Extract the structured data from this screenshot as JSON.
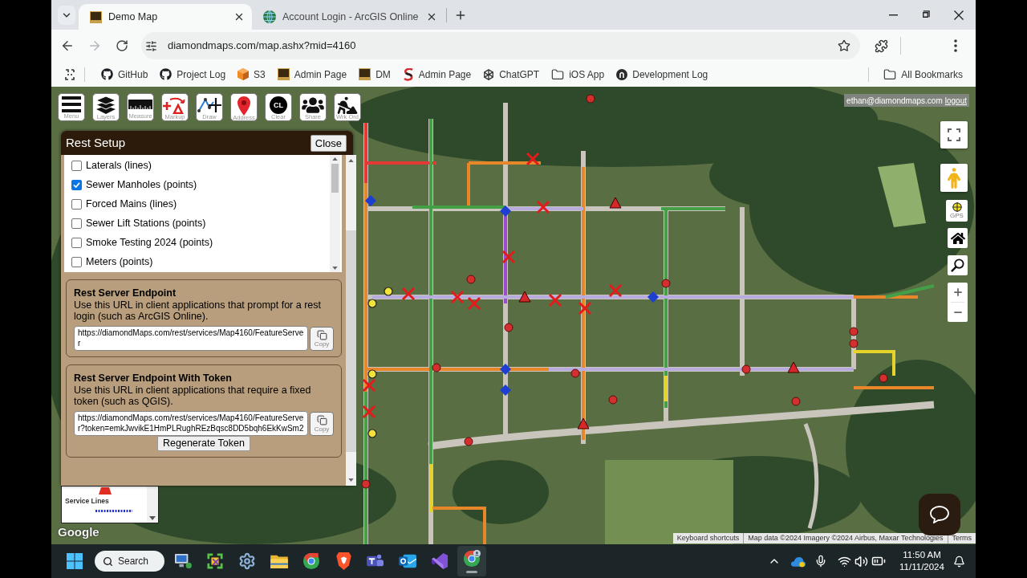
{
  "browser": {
    "tabs": [
      {
        "title": "Demo Map",
        "kind": "dm",
        "selected": true
      },
      {
        "title": "Account Login - ArcGIS Online",
        "kind": "globe",
        "selected": false
      }
    ],
    "address": {
      "url": "diamondmaps.com/map.ashx?mid=4160",
      "forward_disabled": true
    },
    "bookmarks": [
      {
        "label": "GitHub",
        "kind": "github"
      },
      {
        "label": "Project Log",
        "kind": "github"
      },
      {
        "label": "S3",
        "kind": "cube"
      },
      {
        "label": "Admin Page",
        "kind": "dm"
      },
      {
        "label": "DM",
        "kind": "dm"
      },
      {
        "label": "Admin Page",
        "kind": "swirl"
      },
      {
        "label": "ChatGPT",
        "kind": "knot"
      },
      {
        "label": "iOS App",
        "kind": "folder"
      },
      {
        "label": "Development Log",
        "kind": "badge"
      }
    ],
    "all_bookmarks": "All Bookmarks"
  },
  "map": {
    "account": {
      "email": "ethan@diamondmaps.com",
      "link": "logout"
    },
    "toolbar": [
      {
        "label": "Menu",
        "kind": "menu"
      },
      {
        "label": "Layers",
        "kind": "layers"
      },
      {
        "label": "Measure",
        "kind": "measure"
      },
      {
        "label": "Markup",
        "kind": "markup"
      },
      {
        "label": "Draw",
        "kind": "draw"
      },
      {
        "label": "Address",
        "kind": "address"
      },
      {
        "label": "Clear",
        "kind": "clear",
        "icon_text": "CL"
      },
      {
        "label": "Share",
        "kind": "share"
      },
      {
        "label": "Wrk Ord",
        "kind": "workorder"
      }
    ],
    "panel": {
      "title": "Rest Setup",
      "close": "Close",
      "layers": [
        {
          "label": "Laterals (lines)",
          "checked": false
        },
        {
          "label": "Sewer Manholes (points)",
          "checked": true
        },
        {
          "label": "Forced Mains (lines)",
          "checked": false
        },
        {
          "label": "Sewer Lift Stations (points)",
          "checked": false
        },
        {
          "label": "Smoke Testing 2024 (points)",
          "checked": false
        },
        {
          "label": "Meters (points)",
          "checked": false
        }
      ],
      "endpoints": [
        {
          "title": "Rest Server Endpoint",
          "description": "Use this URL in client applications that prompt for a rest login (such as ArcGIS Online).",
          "url": "https://diamondMaps.com/rest/services/Map4160/FeatureServer",
          "copy": "Copy"
        },
        {
          "title": "Rest Server Endpoint With Token",
          "description": "Use this URL in client applications that require a fixed token (such as QGIS).",
          "url": "https://diamondMaps.com/rest/services/Map4160/FeatureServer?token=emkJwvikE1HmPLRughREzBqsc8DD5bqh6EkKwSm2",
          "copy": "Copy",
          "action": "Regenerate Token"
        }
      ]
    },
    "legend": {
      "label": "Service Lines"
    },
    "gps": "GPS",
    "logo": "Google",
    "attribution": [
      "Keyboard shortcuts",
      "Map data ©2024 Imagery ©2024 Airbus, Maxar Technologies",
      "Terms"
    ]
  },
  "taskbar": {
    "search": "Search",
    "apps": [
      {
        "kind": "computer",
        "selected": false
      },
      {
        "kind": "snip",
        "selected": false
      },
      {
        "kind": "gear",
        "selected": false
      },
      {
        "kind": "folder",
        "selected": false
      },
      {
        "kind": "chrome",
        "selected": false
      },
      {
        "kind": "shield",
        "selected": false
      },
      {
        "kind": "teams",
        "selected": false
      },
      {
        "kind": "mail",
        "selected": false
      },
      {
        "kind": "ribbon",
        "selected": false
      },
      {
        "kind": "chrome_profile",
        "selected": true
      }
    ],
    "time": "11:50 AM",
    "date": "11/11/2024"
  }
}
